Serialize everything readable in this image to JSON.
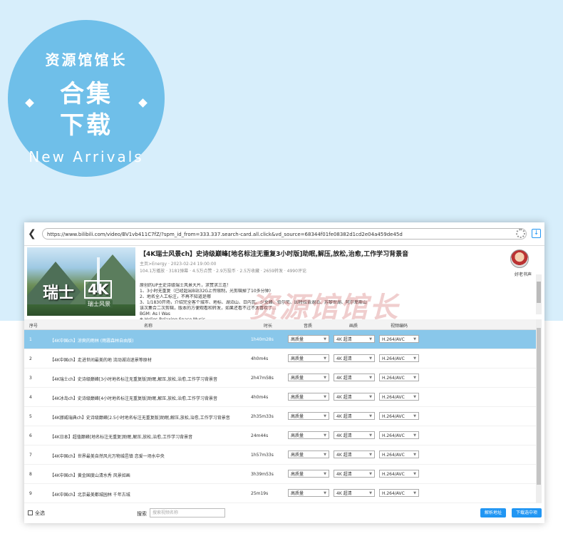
{
  "badge": {
    "ring_top": "资源馆馆长",
    "title_line1": "合集",
    "title_line2": "下载",
    "ring_bottom": "New Arrivals"
  },
  "browser": {
    "url": "https://www.bilibili.com/video/BV1vb411C7fZ/?spm_id_from=333.337.search-card.all.click&vd_source=68344f01fe08382d1cd2e04a459de45d"
  },
  "video": {
    "title": "【4K瑞士风景ch】史诗级巅峰[地名标注无重复3小时版]助眠,解压,放松,治愈,工作学习背景音",
    "thumbnail_text": "瑞士",
    "thumbnail_badge": "4K",
    "thumbnail_sub": "瑞士风景",
    "uploader_line": "主页>Energy · 2023-02-24 19:00:00",
    "stats_line": "104.1万播放 · 3181弹幕 · 4.5万点赞 · 2.9万投币 · 2.5万收藏 · 2659转发 · 4990评论",
    "desc_lines": [
      "原创的UP主史诗级瑞士风景大片，求赞求三连！",
      "1、3小时无重复（已经超出B站32G上传限制，光剪辑掉了10多分钟）",
      "2、地名全人工标注，不再不知道是哪",
      "3、1/1830开场，介绍完全客个城市、地标、湖泊山、日内瓦、少女峰、伯尔尼、因特拉肯湖泊、苏黎世湖、阿尔卑斯山",
      "该次集合二次剪辑，版本的方便观看和转发，如果还看不过不太喜欢了...",
      "BGM: As I Was",
      "❀ Helios Relaxing Space Music"
    ],
    "author_name": "好老书声"
  },
  "watermark": "资源馆馆长",
  "table": {
    "headers": {
      "index": "序号",
      "name": "名称",
      "duration": "时长",
      "audio": "音质",
      "video": "画质",
      "codec": "视频编码"
    },
    "rows": [
      {
        "index": "1",
        "name": "【4K中国ch】涼爽的雨林 (雨霧森林自由版)",
        "duration": "1h40m28s",
        "audio": "高质量",
        "video": "4K 超清",
        "codec": "H.264/AVC",
        "selected": true
      },
      {
        "index": "2",
        "name": "【4K中国ch】走进世间最美的地 流动湖泊迷景等原材",
        "duration": "4h0m4s",
        "audio": "高质量",
        "video": "4K 超清",
        "codec": "H.264/AVC",
        "selected": false
      },
      {
        "index": "3",
        "name": "【4K瑞士ch】史诗级巅峰[3小时地名标注无重复版]助眠,解压,放松,治愈,工作学习背景音",
        "duration": "2h47m58s",
        "audio": "高质量",
        "video": "4K 超清",
        "codec": "H.264/AVC",
        "selected": false
      },
      {
        "index": "4",
        "name": "【4K冰岛ch】史诗级巅峰[4小时地名标注无重复版]助眠,解压,放松,治愈,工作学习背景音",
        "duration": "4h0m4s",
        "audio": "高质量",
        "video": "4K 超清",
        "codec": "H.264/AVC",
        "selected": false
      },
      {
        "index": "5",
        "name": "【4K挪威瑞典ch】史诗级巅峰[2.5小时地名标注无重复版]助眠,解压,放松,治愈,工作学习背景音",
        "duration": "2h35m33s",
        "audio": "高质量",
        "video": "4K 超清",
        "codec": "H.264/AVC",
        "selected": false
      },
      {
        "index": "6",
        "name": "【4K日本】超值巅峰[地名标注无重复]助眠,解压,放松,治愈,工作学习背景音",
        "duration": "24m44s",
        "audio": "高质量",
        "video": "4K 超清",
        "codec": "H.264/AVC",
        "selected": false
      },
      {
        "index": "7",
        "name": "【4K中国ch】世界最美自然风光万物城邑镇 恋爱一场水中央",
        "duration": "1h57m33s",
        "audio": "高质量",
        "video": "4K 超清",
        "codec": "H.264/AVC",
        "selected": false
      },
      {
        "index": "8",
        "name": "【4K中国ch】黄金国度山清水秀 风景如画",
        "duration": "3h39m53s",
        "audio": "高质量",
        "video": "4K 超清",
        "codec": "H.264/AVC",
        "selected": false
      },
      {
        "index": "9",
        "name": "【4K中国ch】北京最美都城园林 千年古城",
        "duration": "25m19s",
        "audio": "高质量",
        "video": "4K 超清",
        "codec": "H.264/AVC",
        "selected": false
      }
    ]
  },
  "footer": {
    "select_all": "全选",
    "search_label": "搜索",
    "search_placeholder": "搜索视频名称",
    "parse_button": "解析地址",
    "download_button": "下载选中项"
  }
}
